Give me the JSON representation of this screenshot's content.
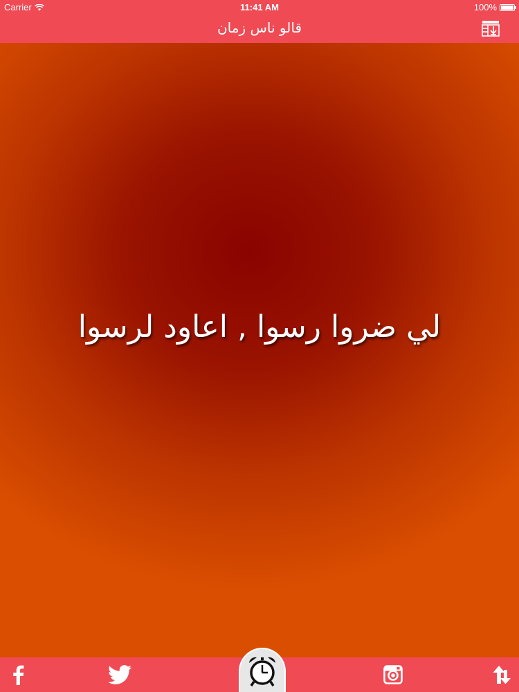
{
  "status_bar": {
    "carrier": "Carrier",
    "time": "11:41 AM",
    "battery": "100%",
    "battery_level": 1.0
  },
  "nav_bar": {
    "title": "قالو ناس زمان",
    "menu_icon": "list-download-icon"
  },
  "main": {
    "quote": "لي ضروا رسوا , اعاود لرسوا"
  },
  "tab_bar": {
    "items": [
      {
        "icon": "facebook-icon"
      },
      {
        "icon": "twitter-icon"
      },
      {
        "icon": "alarm-clock-icon"
      },
      {
        "icon": "instagram-icon"
      },
      {
        "icon": "shuffle-arrows-icon"
      }
    ]
  },
  "colors": {
    "bar": "#f04a55",
    "gradient_center": "#8a0300",
    "gradient_edge": "#d94e00",
    "text": "#ffffff"
  }
}
